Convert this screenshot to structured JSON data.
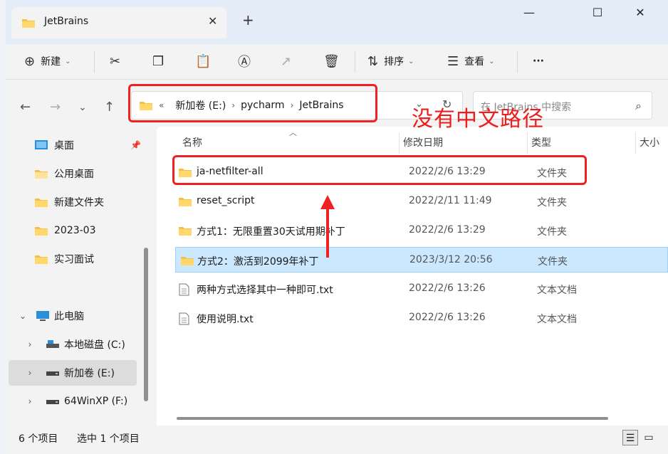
{
  "window": {
    "tab_title": "JetBrains",
    "minimize": "—",
    "maximize": "☐",
    "close": "✕"
  },
  "toolbar": {
    "new_label": "新建",
    "sort_label": "排序",
    "view_label": "查看",
    "more_label": "···"
  },
  "address": {
    "overflow": "«",
    "crumbs": [
      "新加卷 (E:)",
      "pycharm",
      "JetBrains"
    ],
    "search_placeholder": "在 JetBrains 中搜索"
  },
  "sidebar": {
    "items": [
      {
        "label": "桌面",
        "pinned": true
      },
      {
        "label": "公用桌面"
      },
      {
        "label": "新建文件夹"
      },
      {
        "label": "2023-03"
      },
      {
        "label": "实习面试"
      },
      {
        "label": "此电脑"
      },
      {
        "label": "本地磁盘 (C:)"
      },
      {
        "label": "新加卷 (E:)",
        "selected": true
      },
      {
        "label": "64WinXP  (F:)"
      }
    ]
  },
  "columns": {
    "name": "名称",
    "modified": "修改日期",
    "type": "类型",
    "size": "大小"
  },
  "files": [
    {
      "name": "ja-netfilter-all",
      "modified": "2022/2/6 13:29",
      "type": "文件夹",
      "kind": "folder"
    },
    {
      "name": "reset_script",
      "modified": "2022/2/11 11:49",
      "type": "文件夹",
      "kind": "folder"
    },
    {
      "name": "方式1：无限重置30天试用期补丁",
      "modified": "2022/2/6 13:29",
      "type": "文件夹",
      "kind": "folder"
    },
    {
      "name": "方式2：激活到2099年补丁",
      "modified": "2023/3/12 20:56",
      "type": "文件夹",
      "kind": "folder",
      "selected": true
    },
    {
      "name": "两种方式选择其中一种即可.txt",
      "modified": "2022/2/6 13:26",
      "type": "文本文档",
      "kind": "text"
    },
    {
      "name": "使用说明.txt",
      "modified": "2022/2/6 13:26",
      "type": "文本文档",
      "kind": "text"
    }
  ],
  "status": {
    "count": "6 个项目",
    "selected": "选中 1 个项目"
  },
  "annotation": {
    "text": "没有中文路径",
    "color": "#ee2222"
  },
  "colors": {
    "folder": "#f4c04a",
    "selection": "#cce8ff",
    "accent": "#0067c0"
  }
}
